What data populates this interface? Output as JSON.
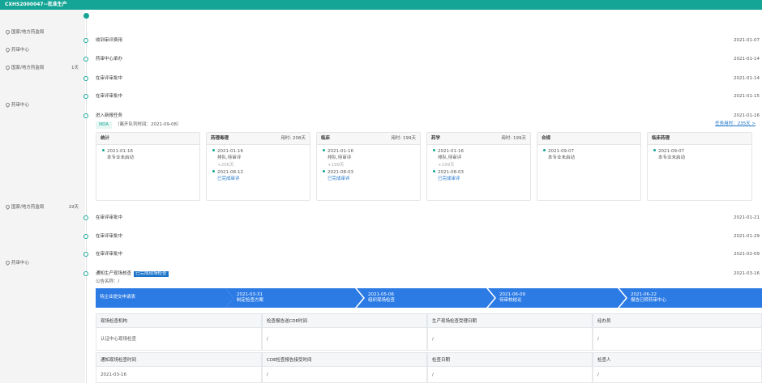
{
  "header": {
    "title": "CXHS2000047--批准生产"
  },
  "sidebar": {
    "labels": [
      {
        "text": "国家/地方药监局",
        "duration": ""
      },
      {
        "text": "药审中心",
        "duration": ""
      },
      {
        "text": "国家/地方药监局",
        "duration": "1天"
      },
      {
        "text": "药审中心",
        "duration": ""
      },
      {
        "text": "国家/地方药监局",
        "duration": "19天"
      },
      {
        "text": "药审中心",
        "duration": ""
      }
    ],
    "task_link": "任务用时：235天 >"
  },
  "timeline": [
    {
      "date": "2021-01-07",
      "event": "收到审评费用"
    },
    {
      "date": "2021-01-14",
      "event": "药审中心承办"
    },
    {
      "date": "2021-01-14",
      "event": "在审评审批中"
    },
    {
      "date": "2021-01-15",
      "event": "在审评审批中"
    },
    {
      "date": "2021-01-16",
      "event": "进入新报任务"
    },
    {
      "date": "2021-01-21",
      "event": "在审评审批中"
    },
    {
      "date": "2021-01-29",
      "event": "在审评审批中"
    },
    {
      "date": "2021-02-09",
      "event": "在审评审批中"
    },
    {
      "date": "2021-03-16",
      "event": "通知生产现场核查"
    }
  ],
  "task": {
    "tag": "NDA",
    "pending": "（离开队列时间：2021-09-08）",
    "cards": [
      {
        "title": "统计",
        "used": "",
        "date1": "2021-01-16",
        "status1": "本专业未启动",
        "gap": "",
        "date2": "",
        "status2": ""
      },
      {
        "title": "药理毒理",
        "used": "用时: 208天",
        "date1": "2021-01-16",
        "status1": "排队,待审评",
        "gap": "+206天",
        "date2": "2021-08-12",
        "status2": "已完成审评"
      },
      {
        "title": "临床",
        "used": "用时: 199天",
        "date1": "2021-01-16",
        "status1": "排队,待审评",
        "gap": "+199天",
        "date2": "2021-08-03",
        "status2": "已完成审评"
      },
      {
        "title": "药学",
        "used": "用时: 199天",
        "date1": "2021-01-16",
        "status1": "排队,待审评",
        "gap": "+199天",
        "date2": "2021-08-03",
        "status2": "已完成审评"
      },
      {
        "title": "合规",
        "used": "",
        "date1": "2021-09-07",
        "status1": "本专业未启动",
        "gap": "",
        "date2": "",
        "status2": ""
      },
      {
        "title": "临床药理",
        "used": "",
        "date1": "2021-09-07",
        "status1": "本专业未启动",
        "gap": "",
        "date2": "",
        "status2": ""
      }
    ]
  },
  "inspection": {
    "badge": "已完成现场检查",
    "notice": "公告名称：/",
    "steps": [
      {
        "date": "",
        "label": "待企业提交申请表"
      },
      {
        "date": "2021-03-31",
        "label": "制定检查方案"
      },
      {
        "date": "2021-05-06",
        "label": "组织现场检查"
      },
      {
        "date": "2021-06-09",
        "label": "待审核结论"
      },
      {
        "date": "2021-06-22",
        "label": "报告已转药审中心"
      }
    ],
    "table": {
      "row1_headers": [
        "现场检查机构",
        "检查报告送CDE时间",
        "生产现场检查受理日期",
        "经办员"
      ],
      "row1_values": [
        "认证中心现场检查",
        "/",
        "/",
        "/"
      ],
      "row2_headers": [
        "通知现场检查时间",
        "CDE检查报告接受时间",
        "检查日期",
        "检查人"
      ],
      "row2_values": [
        "2021-03-16",
        "/",
        "/",
        "/"
      ]
    }
  },
  "colors": {
    "accent": "#14a596",
    "arrow": "#2c7be5",
    "link": "#1a73c9"
  }
}
